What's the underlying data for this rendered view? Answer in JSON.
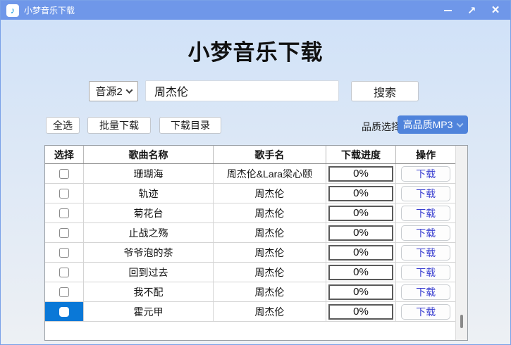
{
  "window": {
    "title": "小梦音乐下载"
  },
  "header": {
    "title": "小梦音乐下载"
  },
  "search": {
    "source_value": "音源2",
    "input_value": "周杰伦",
    "search_label": "搜索"
  },
  "toolbar": {
    "select_all_label": "全选",
    "batch_download_label": "批量下载",
    "download_dir_label": "下载目录",
    "quality_label": "品质选择",
    "quality_value": "高品质MP3"
  },
  "table": {
    "headers": [
      "选择",
      "歌曲名称",
      "歌手名",
      "下载进度",
      "操作"
    ],
    "download_label": "下载",
    "rows": [
      {
        "song": "珊瑚海",
        "artist": "周杰伦&Lara梁心颐",
        "progress": "0%",
        "selected": false
      },
      {
        "song": "轨迹",
        "artist": "周杰伦",
        "progress": "0%",
        "selected": false
      },
      {
        "song": "菊花台",
        "artist": "周杰伦",
        "progress": "0%",
        "selected": false
      },
      {
        "song": "止战之殇",
        "artist": "周杰伦",
        "progress": "0%",
        "selected": false
      },
      {
        "song": "爷爷泡的茶",
        "artist": "周杰伦",
        "progress": "0%",
        "selected": false
      },
      {
        "song": "回到过去",
        "artist": "周杰伦",
        "progress": "0%",
        "selected": false
      },
      {
        "song": "我不配",
        "artist": "周杰伦",
        "progress": "0%",
        "selected": false
      },
      {
        "song": "霍元甲",
        "artist": "周杰伦",
        "progress": "0%",
        "selected": true
      }
    ]
  },
  "icons": {
    "app_icon": "music-note",
    "minimize": "minimize",
    "maximize": "maximize-arrow",
    "close": "close"
  },
  "colors": {
    "titlebar": "#6f97e9",
    "quality_dropdown": "#4f83db",
    "selected_cell": "#0a78d7",
    "download_text": "#3a3fd0",
    "bg_top": "#cfe1f8",
    "bg_bottom": "#edf0f4"
  }
}
